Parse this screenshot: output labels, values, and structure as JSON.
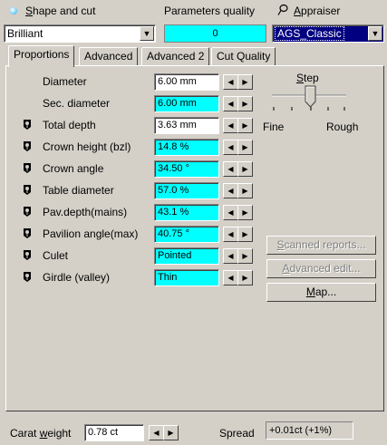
{
  "header": {
    "shape_label": "Shape and cut",
    "params_quality_label": "Parameters quality",
    "appraiser_label": "Appraiser"
  },
  "shape_select": {
    "value": "Brilliant"
  },
  "quality_value": "0",
  "appraiser_select": {
    "value": "AGS_Classic"
  },
  "tabs": [
    {
      "label": "Proportions"
    },
    {
      "label": "Advanced"
    },
    {
      "label": "Advanced 2"
    },
    {
      "label": "Cut Quality"
    }
  ],
  "rows": [
    {
      "label": "Diameter",
      "value": "6.00 mm",
      "locked": false,
      "highlight": false
    },
    {
      "label": "Sec. diameter",
      "value": "6.00 mm",
      "locked": false,
      "highlight": true
    },
    {
      "label": "Total depth",
      "value": "3.63 mm",
      "locked": true,
      "highlight": false
    },
    {
      "label": "Crown height (bzl)",
      "value": "14.8 %",
      "locked": true,
      "highlight": true
    },
    {
      "label": "Crown angle",
      "value": "34.50 °",
      "locked": true,
      "highlight": true
    },
    {
      "label": "Table diameter",
      "value": "57.0 %",
      "locked": true,
      "highlight": true
    },
    {
      "label": "Pav.depth(mains)",
      "value": "43.1 %",
      "locked": true,
      "highlight": true
    },
    {
      "label": "Pavilion angle(max)",
      "value": "40.75 °",
      "locked": true,
      "highlight": true
    },
    {
      "label": "Culet",
      "value": "Pointed",
      "locked": true,
      "highlight": true
    },
    {
      "label": "Girdle (valley)",
      "value": "Thin",
      "locked": true,
      "highlight": true
    }
  ],
  "step": {
    "label": "Step",
    "fine_label": "Fine",
    "rough_label": "Rough"
  },
  "buttons": {
    "scanned_reports": "Scanned reports...",
    "advanced_edit": "Advanced edit...",
    "map": "Map..."
  },
  "footer": {
    "carat_label": "Carat weight",
    "carat_value": "0.78 ct",
    "spread_label": "Spread",
    "spread_value": "+0.01ct (+1%)"
  },
  "colors": {
    "highlight": "#00ffff",
    "selected_appraiser": "#000080",
    "window_bg": "#d4d0c8"
  },
  "icons": {
    "shape": "dot-icon",
    "appraiser": "pushpin-icon",
    "lock": "pin-lock-icon",
    "left": "arrow-left-icon",
    "right": "arrow-right-icon"
  }
}
